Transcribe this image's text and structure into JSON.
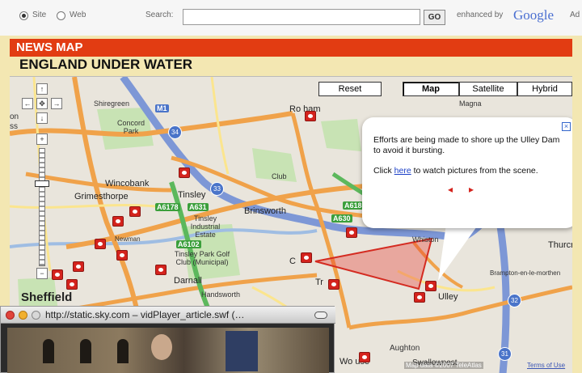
{
  "search": {
    "radio_site": "Site",
    "radio_web": "Web",
    "label": "Search:",
    "value": "",
    "button": "GO",
    "enhanced_by": "enhanced by",
    "google": "Google",
    "ad": "Ad"
  },
  "banner": {
    "title": "NEWS MAP"
  },
  "headline": "ENGLAND UNDER WATER",
  "map": {
    "reset": "Reset",
    "types": [
      "Map",
      "Satellite",
      "Hybrid"
    ],
    "selected_type": "Map",
    "nav": {
      "up": "↑",
      "left": "←",
      "center": "✥",
      "right": "→",
      "down": "↓",
      "zoom_in": "+",
      "zoom_out": "−"
    },
    "places": {
      "rotherham": "Ro    ham",
      "shiregreen": "Shiregreen",
      "concord_park": "Concord Park",
      "wincobank": "Wincobank",
      "grimesthorpe": "Grimesthorpe",
      "tinsley": "Tinsley",
      "tinsley_ie": "Tinsley Industrial Estate",
      "tinsley_golf": "Tinsley Park Golf Club (Municipal)",
      "brinsworth": "Brinsworth",
      "darnall": "Darnall",
      "handsworth": "Handsworth",
      "sheffield": "Sheffield",
      "magna": "Magna",
      "ulley": "Ulley",
      "aughton": "Aughton",
      "woodhouse": "Wo   use",
      "swallownest": "Swallownest",
      "thurcroft": "Thurcro",
      "brampton": "Brampton-en-le-morthen",
      "c_label": "C",
      "tr_label": "Tr",
      "ess": "ss",
      "on": "on",
      "club": "Club",
      "whiston": "Whiston",
      "newman": "Newman"
    },
    "roads": {
      "a6178": "A6178",
      "a631": "A631",
      "a6102": "A6102",
      "a630": "A630",
      "a618": "A618",
      "m1": "M1"
    },
    "junctions": {
      "j34": "34",
      "j33": "33",
      "j32": "32",
      "j31": "31"
    },
    "copyright": "Map data ©2007 TeleAtlas",
    "terms": "Terms of Use"
  },
  "bubble": {
    "text1": "Efforts are being made to shore up the Ulley Dam to avoid it bursting.",
    "click": "Click",
    "link": "here",
    "text2": "to watch pictures from the scene.",
    "prev": "◂",
    "next": "▸",
    "close": "×"
  },
  "video": {
    "url": "http://static.sky.com – vidPlayer_article.swf (…"
  },
  "colors": {
    "banner": "#e23c12",
    "motorway": "#7d97d6",
    "a_road": "#f0a24a",
    "green": "#b8dca3",
    "flood_polygon": "#e7332a"
  }
}
